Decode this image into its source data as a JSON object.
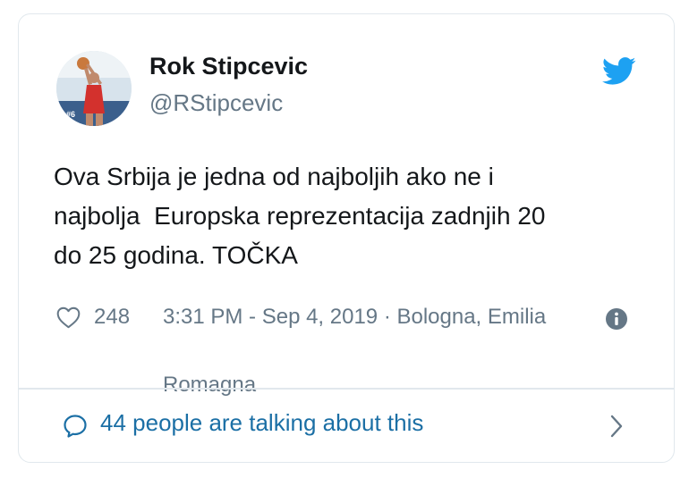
{
  "user": {
    "name": "Rok Stipcevic",
    "handle": "@RStipcevic",
    "avatar_icon": "basketball-player-photo",
    "jersey": "#6"
  },
  "tweet": {
    "lines": [
      "Ova Srbija je jedna od najboljih ako ne i",
      "najbolja  Europska reprezentacija zadnjih 20",
      "do 25 godina. TOČKA"
    ]
  },
  "meta": {
    "likes": "248",
    "timestamp": "3:31 PM - Sep 4, 2019 · Bologna, Emilia",
    "location_cont": "Romagna",
    "heart_icon": "heart-outline-icon",
    "info_icon": "info-icon"
  },
  "footer": {
    "talking": "44 people are talking about this",
    "bubble_icon": "speech-bubble-icon",
    "chevron_icon": "chevron-right-icon"
  },
  "colors": {
    "twitter_blue": "#1da1f2",
    "link_blue": "#1b6fa5",
    "text": "#14171a",
    "muted": "#657786",
    "border": "#e1e8ed"
  }
}
